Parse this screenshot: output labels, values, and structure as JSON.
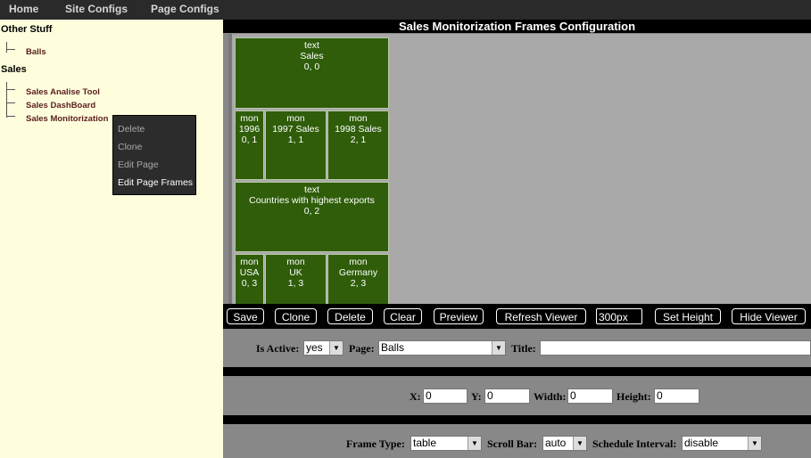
{
  "topnav": [
    "Home",
    "Site Configs",
    "Page Configs"
  ],
  "sidebar": {
    "sections": [
      {
        "title": "Other Stuff",
        "items": [
          "Balls"
        ]
      },
      {
        "title": "Sales",
        "items": [
          "Sales Analise Tool",
          "Sales DashBoard",
          "Sales Monitorization"
        ]
      }
    ]
  },
  "context_menu": {
    "items": [
      "Delete",
      "Clone",
      "Edit Page",
      "Edit Page Frames"
    ],
    "active": "Edit Page Frames"
  },
  "main": {
    "title": "Sales Monitorization Frames Configuration",
    "frames": [
      {
        "lines": [
          "text",
          "Sales",
          "0, 0"
        ]
      },
      {
        "lines": [
          "mon",
          "1996",
          "0, 1"
        ]
      },
      {
        "lines": [
          "mon",
          "1997 Sales",
          "1, 1"
        ]
      },
      {
        "lines": [
          "mon",
          "1998 Sales",
          "2, 1"
        ]
      },
      {
        "lines": [
          "text",
          "Countries with highest exports",
          "0, 2"
        ]
      },
      {
        "lines": [
          "mon",
          "USA",
          "0, 3"
        ]
      },
      {
        "lines": [
          "mon",
          "UK",
          "1, 3"
        ]
      },
      {
        "lines": [
          "mon",
          "Germany",
          "2, 3"
        ]
      }
    ],
    "toolbar": {
      "save": "Save",
      "clone": "Clone",
      "delete": "Delete",
      "clear": "Clear",
      "preview": "Preview",
      "refresh_viewer": "Refresh Viewer",
      "height_value": "300px",
      "set_height": "Set Height",
      "hide_viewer": "Hide Viewer"
    },
    "form": {
      "is_active_label": "Is Active:",
      "is_active_value": "yes",
      "page_label": "Page:",
      "page_value": "Balls",
      "title_label": "Title:",
      "title_value": "",
      "x_label": "X:",
      "x_value": "0",
      "y_label": "Y:",
      "y_value": "0",
      "width_label": "Width:",
      "width_value": "0",
      "height_label": "Height:",
      "height_value": "0",
      "frame_type_label": "Frame Type:",
      "frame_type_value": "table",
      "scroll_bar_label": "Scroll Bar:",
      "scroll_bar_value": "auto",
      "schedule_interval_label": "Schedule Interval:",
      "schedule_interval_value": "disable"
    }
  }
}
